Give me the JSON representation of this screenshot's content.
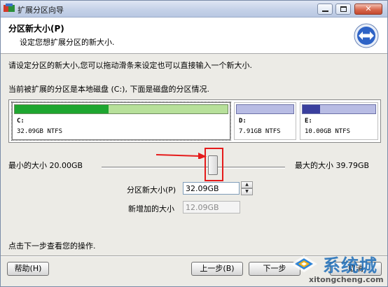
{
  "window": {
    "title": "扩展分区向导"
  },
  "header": {
    "title": "分区新大小(P)",
    "subtitle": "设定您想扩展分区的新大小."
  },
  "instructions": {
    "line1": "请设定分区的新大小,您可以拖动滑条来设定也可以直接输入一个新大小.",
    "line2": "当前被扩展的分区是本地磁盘 (C:), 下面是磁盘的分区情况."
  },
  "partitions": [
    {
      "label": "C:",
      "info": "32.09GB NTFS",
      "used_fraction": 0.44,
      "color": "#1ea630"
    },
    {
      "label": "D:",
      "info": "7.91GB NTFS",
      "used_fraction": 0.0,
      "color": "#3a3f9e"
    },
    {
      "label": "E:",
      "info": "10.00GB NTFS",
      "used_fraction": 0.24,
      "color": "#3a3f9e"
    }
  ],
  "slider": {
    "min_label": "最小的大小 20.00GB",
    "max_label": "最大的大小 39.79GB"
  },
  "fields": {
    "new_size_label": "分区新大小(P)",
    "new_size_value": "32.09GB",
    "added_label": "新增加的大小",
    "added_value": "12.09GB"
  },
  "footer_hint": "点击下一步查看您的操作.",
  "buttons": {
    "help": "帮助(H)",
    "back": "上一步(B)",
    "next": "下一步",
    "cancel": "取消"
  },
  "watermark": {
    "name": "系统城",
    "url": "xitongcheng.com"
  },
  "colors": {
    "highlight": "#e51b1b",
    "accent": "#1d6db8"
  }
}
